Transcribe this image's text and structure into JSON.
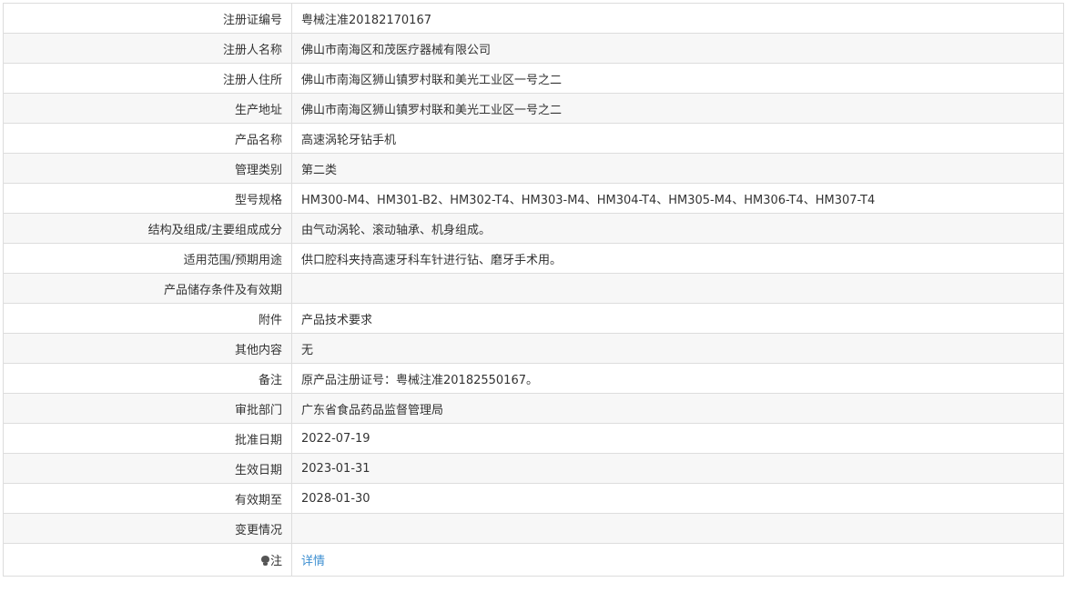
{
  "rows": [
    {
      "label": "注册证编号",
      "value": "粤械注准20182170167"
    },
    {
      "label": "注册人名称",
      "value": "佛山市南海区和茂医疗器械有限公司"
    },
    {
      "label": "注册人住所",
      "value": "佛山市南海区狮山镇罗村联和美光工业区一号之二"
    },
    {
      "label": "生产地址",
      "value": "佛山市南海区狮山镇罗村联和美光工业区一号之二"
    },
    {
      "label": "产品名称",
      "value": "高速涡轮牙钻手机"
    },
    {
      "label": "管理类别",
      "value": "第二类"
    },
    {
      "label": "型号规格",
      "value": "HM300-M4、HM301-B2、HM302-T4、HM303-M4、HM304-T4、HM305-M4、HM306-T4、HM307-T4"
    },
    {
      "label": "结构及组成/主要组成成分",
      "value": "由气动涡轮、滚动轴承、机身组成。"
    },
    {
      "label": "适用范围/预期用途",
      "value": "供口腔科夹持高速牙科车针进行钻、磨牙手术用。"
    },
    {
      "label": "产品储存条件及有效期",
      "value": ""
    },
    {
      "label": "附件",
      "value": "产品技术要求"
    },
    {
      "label": "其他内容",
      "value": "无"
    },
    {
      "label": "备注",
      "value": "原产品注册证号：粤械注准20182550167。"
    },
    {
      "label": "审批部门",
      "value": "广东省食品药品监督管理局"
    },
    {
      "label": "批准日期",
      "value": "2022-07-19"
    },
    {
      "label": "生效日期",
      "value": "2023-01-31"
    },
    {
      "label": "有效期至",
      "value": "2028-01-30"
    },
    {
      "label": "变更情况",
      "value": ""
    }
  ],
  "note_row": {
    "icon": "lightbulb-icon",
    "label": "注",
    "link_text": "详情"
  },
  "colors": {
    "border": "#dddddd",
    "row_alt": "#f7f7f7",
    "link": "#3d8fd1",
    "text": "#333333"
  }
}
